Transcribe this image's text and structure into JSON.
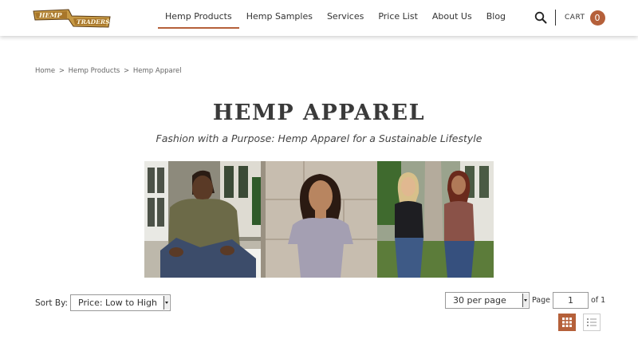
{
  "brand": {
    "logo_line1": "HEMP",
    "logo_line2": "TRADERS",
    "accent_color": "#b5603a"
  },
  "nav": {
    "items": [
      {
        "label": "Hemp Products",
        "active": true
      },
      {
        "label": "Hemp Samples",
        "active": false
      },
      {
        "label": "Services",
        "active": false
      },
      {
        "label": "Price List",
        "active": false
      },
      {
        "label": "About Us",
        "active": false
      },
      {
        "label": "Blog",
        "active": false
      }
    ]
  },
  "header": {
    "search_icon": "search-icon",
    "cart_label": "CART",
    "cart_count": "0"
  },
  "breadcrumb": {
    "items": [
      "Home",
      "Hemp Products",
      "Hemp Apparel"
    ],
    "separator": ">"
  },
  "page": {
    "title": "HEMP APPAREL",
    "subtitle": "Fashion with a Purpose: Hemp Apparel for a Sustainable Lifestyle"
  },
  "controls": {
    "sort_label": "Sort By:",
    "sort_value": "Price: Low to High",
    "per_page_value": "30 per page",
    "page_label": "Page",
    "page_value": "1",
    "of_label": "of 1",
    "grid_view_icon": "grid-view-icon",
    "list_view_icon": "list-view-icon"
  }
}
